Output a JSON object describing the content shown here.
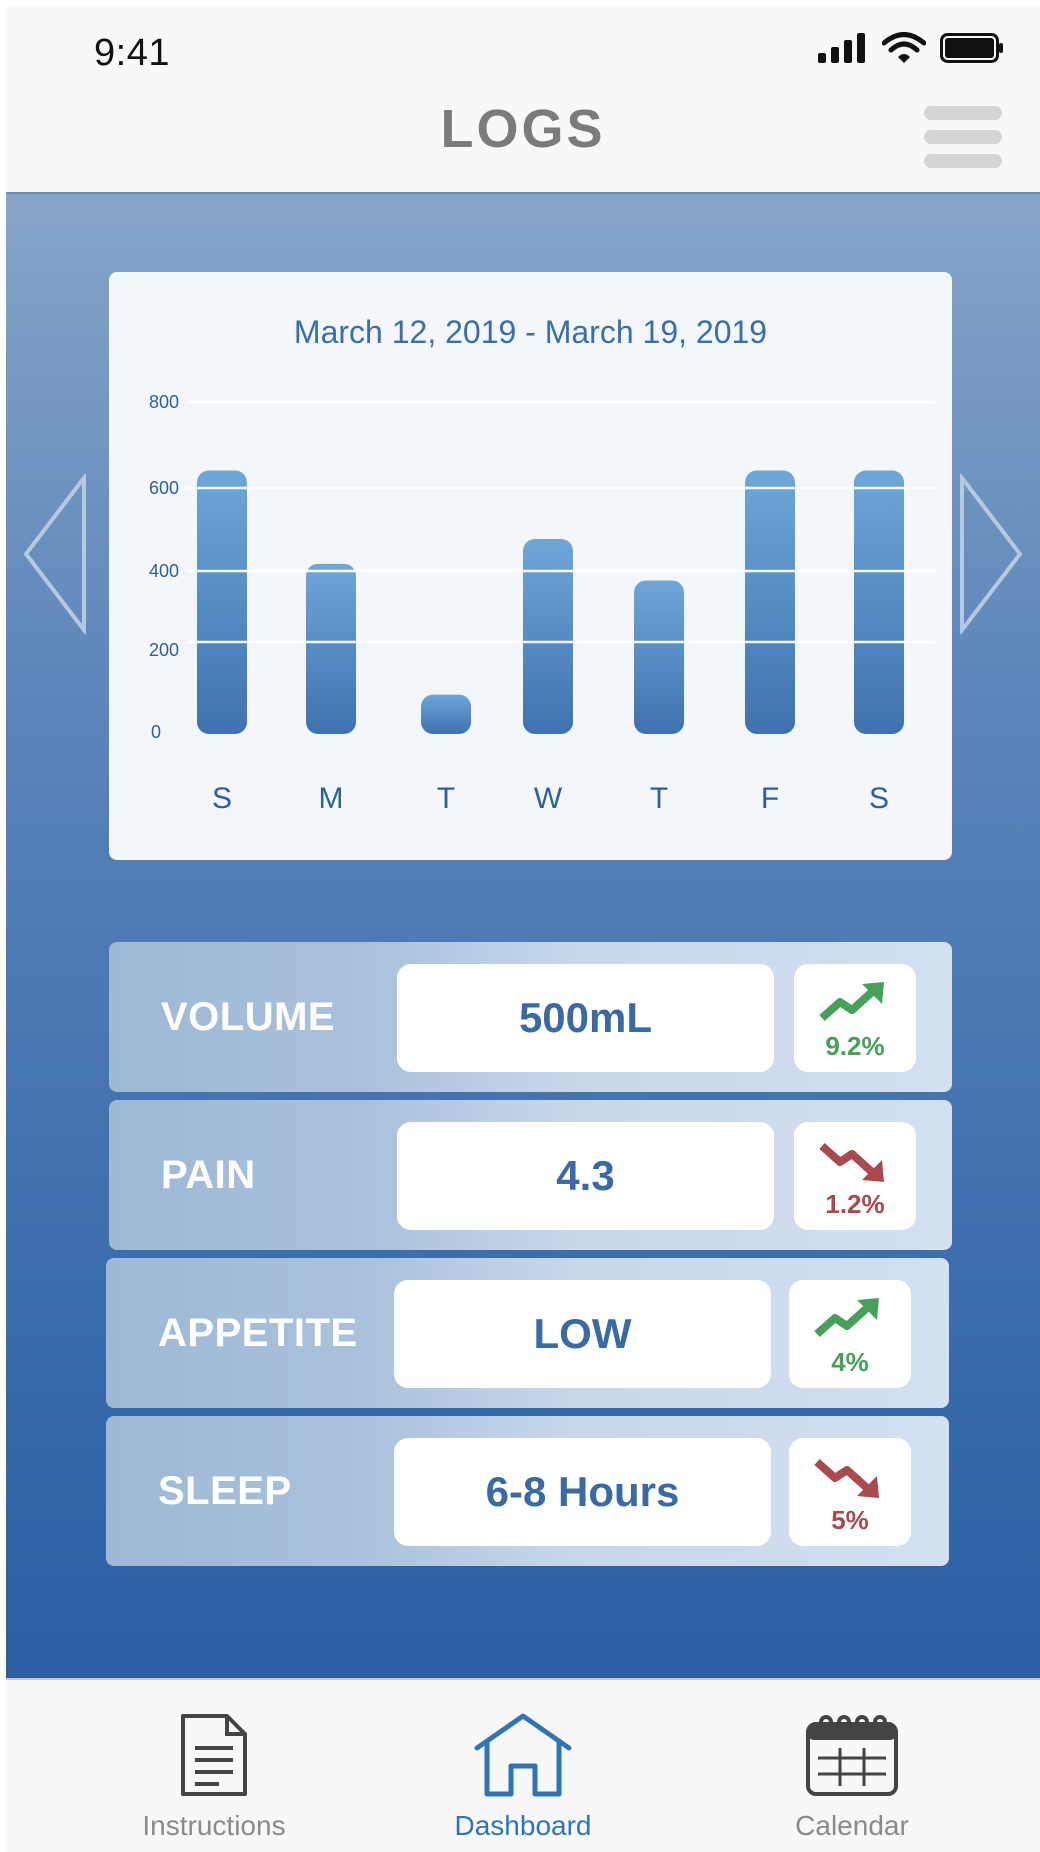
{
  "status_bar": {
    "time": "9:41"
  },
  "header": {
    "title": "LOGS"
  },
  "chart": {
    "title": "March 12, 2019 - March 19, 2019"
  },
  "chart_data": {
    "type": "bar",
    "title": "March 12, 2019 - March 19, 2019",
    "categories": [
      "S",
      "M",
      "T",
      "W",
      "T",
      "F",
      "S"
    ],
    "values": [
      635,
      410,
      95,
      470,
      370,
      635,
      635
    ],
    "y_ticks": [
      0,
      200,
      400,
      600,
      800
    ],
    "ylim": [
      0,
      800
    ],
    "grid": true,
    "colors": {
      "bar_top": "#6fa6d8",
      "bar_bottom": "#3f72b0",
      "tick": "#2f5f9a"
    }
  },
  "metrics": [
    {
      "label": "VOLUME",
      "value": "500mL",
      "trend": "up",
      "change": "9.2%"
    },
    {
      "label": "PAIN",
      "value": "4.3",
      "trend": "down",
      "change": "1.2%"
    },
    {
      "label": "APPETITE",
      "value": "LOW",
      "trend": "up",
      "change": "4%"
    },
    {
      "label": "SLEEP",
      "value": "6-8 Hours",
      "trend": "down",
      "change": "5%"
    }
  ],
  "colors": {
    "up": "#47a05a",
    "down": "#a94a4e",
    "accent": "#2f74b8",
    "inactive": "#8a8a8a"
  },
  "tabs": [
    {
      "label": "Instructions",
      "icon": "document-icon",
      "active": false
    },
    {
      "label": "Dashboard",
      "icon": "home-icon",
      "active": true
    },
    {
      "label": "Calendar",
      "icon": "calendar-icon",
      "active": false
    }
  ]
}
